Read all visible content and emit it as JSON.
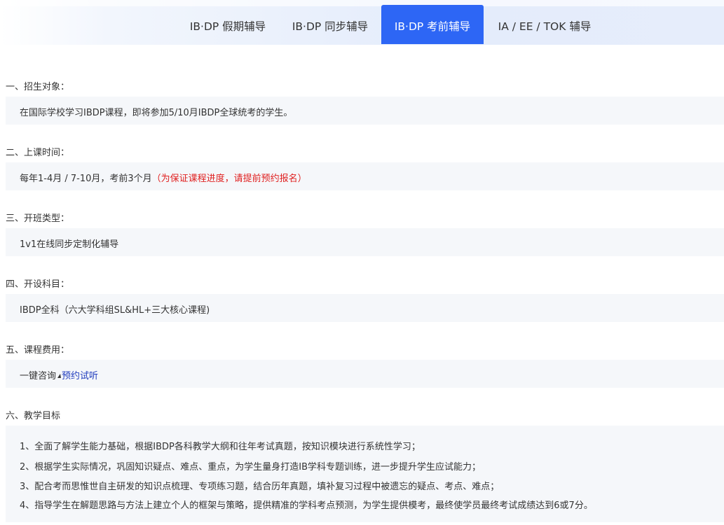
{
  "tabs": [
    {
      "label": "IB·DP 假期辅导",
      "active": false
    },
    {
      "label": "IB·DP 同步辅导",
      "active": false
    },
    {
      "label": "IB·DP 考前辅导",
      "active": true
    },
    {
      "label": "IA / EE / TOK 辅导",
      "active": false
    }
  ],
  "sections": {
    "target": {
      "title": "一、招生对象：",
      "text": "在国际学校学习IBDP课程，即将参加5/10月IBDP全球统考的学生。"
    },
    "time": {
      "title": "二、上课时间：",
      "text": "每年1-4月 / 7-10月，考前3个月",
      "note": "（为保证课程进度，请提前预约报名）"
    },
    "class_type": {
      "title": "三、开班类型：",
      "text": "1v1在线同步定制化辅导"
    },
    "subjects": {
      "title": "四、开设科目：",
      "text": "IBDP全科（六大学科组SL&HL+三大核心课程)"
    },
    "fee": {
      "title": "五、课程费用：",
      "text": "一键咨询",
      "link": "预约试听"
    },
    "goals": {
      "title": "六、教学目标",
      "items": [
        "1、全面了解学生能力基础，根据IBDP各科教学大纲和往年考试真题，按知识模块进行系统性学习；",
        "2、根据学生实际情况，巩固知识疑点、难点、重点，为学生量身打造IB学科专题训练，进一步提升学生应试能力；",
        "3、配合考而思惟世自主研发的知识点梳理、专项练习题，结合历年真题，填补复习过程中被遗忘的疑点、考点、难点；",
        "4、指导学生在解题思路与方法上建立个人的框架与策略，提供精准的学科考点预测，为学生提供模考，最终使学员最终考试成绩达到6或7分。"
      ]
    }
  },
  "colors": {
    "accent": "#2d66f5",
    "note_red": "#e02020",
    "link_blue": "#1f3bbd",
    "box_bg": "#f5f7fa"
  },
  "icons": {
    "fee_marker": "triangle-pointer-icon"
  }
}
